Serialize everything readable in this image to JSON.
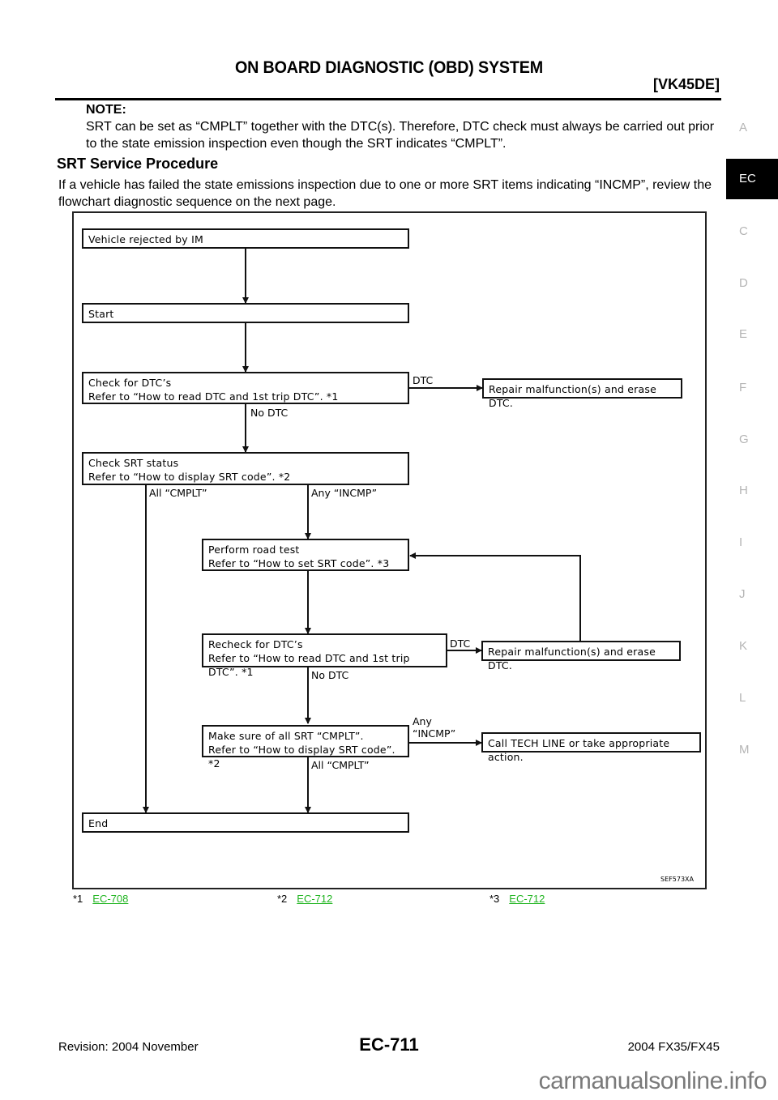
{
  "header": {
    "title": "ON BOARD DIAGNOSTIC (OBD) SYSTEM",
    "engine_code": "[VK45DE]"
  },
  "note": {
    "label": "NOTE:",
    "body": "SRT can be set as “CMPLT” together with the DTC(s). Therefore, DTC check must always be carried out prior to the state emission inspection even though the SRT indicates “CMPLT”."
  },
  "section": {
    "title": "SRT Service Procedure",
    "intro": "If a vehicle has failed the state emissions inspection due to one or more SRT items indicating “INCMP”, review the flowchart diagnostic sequence on the next page."
  },
  "side_tabs": [
    {
      "label": "A",
      "active": false
    },
    {
      "label": "EC",
      "active": true
    },
    {
      "label": "C",
      "active": false
    },
    {
      "label": "D",
      "active": false
    },
    {
      "label": "E",
      "active": false
    },
    {
      "label": "F",
      "active": false
    },
    {
      "label": "G",
      "active": false
    },
    {
      "label": "H",
      "active": false
    },
    {
      "label": "I",
      "active": false
    },
    {
      "label": "J",
      "active": false
    },
    {
      "label": "K",
      "active": false
    },
    {
      "label": "L",
      "active": false
    },
    {
      "label": "M",
      "active": false
    }
  ],
  "flowchart": {
    "boxes": {
      "rejected": {
        "line1": "Vehicle rejected by IM"
      },
      "start": {
        "line1": "Start"
      },
      "check_dtc": {
        "line1": "Check for DTC’s",
        "line2": "Refer to “How to read DTC and 1st trip DTC”. *1"
      },
      "repair1": {
        "line1": "Repair malfunction(s) and erase DTC."
      },
      "check_srt": {
        "line1": "Check SRT status",
        "line2": "Refer to “How to display SRT code”. *2"
      },
      "road_test": {
        "line1": "Perform road test",
        "line2": "Refer to “How to set SRT code”. *3"
      },
      "recheck_dtc": {
        "line1": "Recheck for DTC’s",
        "line2": "Refer to “How to read DTC and 1st trip DTC”. *1"
      },
      "repair2": {
        "line1": "Repair malfunction(s) and erase DTC."
      },
      "make_sure": {
        "line1": "Make sure of all SRT “CMPLT”.",
        "line2": "Refer to “How to display SRT code”. *2"
      },
      "tech_line": {
        "line1": "Call TECH LINE or take appropriate action."
      },
      "end": {
        "line1": "End"
      }
    },
    "labels": {
      "dtc1": "DTC",
      "no_dtc1": "No DTC",
      "all_cmplt1": "All “CMPLT”",
      "any_incmp1": "Any “INCMP”",
      "dtc2": "DTC",
      "no_dtc2": "No DTC",
      "any_incmp2_a": "Any",
      "any_incmp2_b": "“INCMP”",
      "all_cmplt2": "All “CMPLT”"
    },
    "figure_id": "SEF573XA"
  },
  "footnotes": [
    {
      "marker": "*1",
      "link": "EC-708"
    },
    {
      "marker": "*2",
      "link": "EC-712"
    },
    {
      "marker": "*3",
      "link": "EC-712"
    }
  ],
  "footer": {
    "revision": "Revision: 2004 November",
    "page": "EC-711",
    "model": "2004 FX35/FX45"
  },
  "watermark": "carmanualsonline.info",
  "colors": {
    "link": "#21b521",
    "tab_active_bg": "#000000",
    "tab_inactive": "#b5b5b5"
  }
}
